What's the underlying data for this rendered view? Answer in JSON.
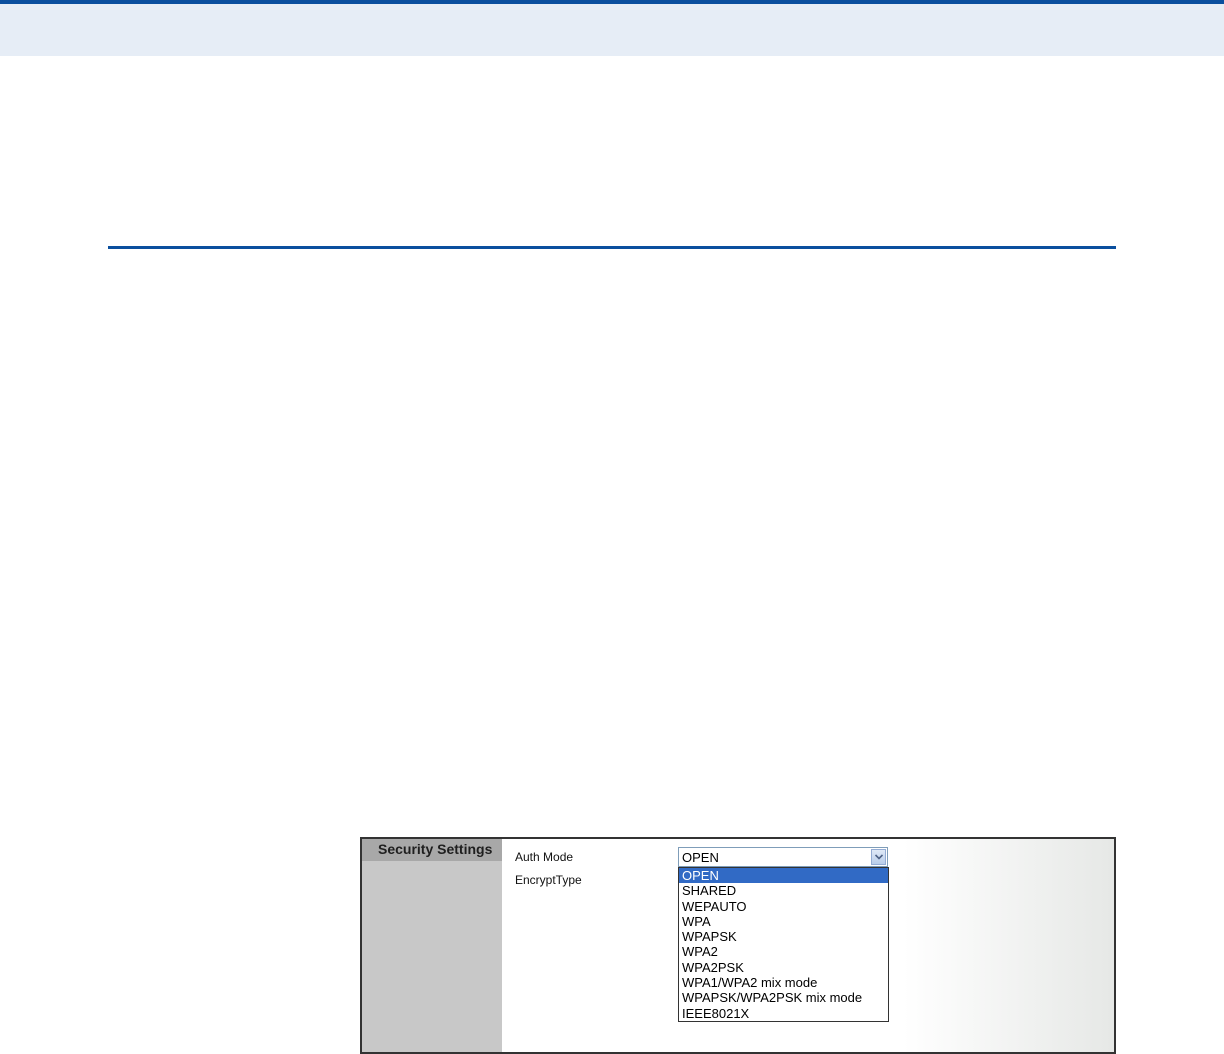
{
  "panel": {
    "title": "Security Settings",
    "fields": {
      "auth_mode_label": "Auth Mode",
      "encrypt_type_label": "EncryptType"
    },
    "auth_mode_select": {
      "value": "OPEN",
      "options": [
        "OPEN",
        "SHARED",
        "WEPAUTO",
        "WPA",
        "WPAPSK",
        "WPA2",
        "WPA2PSK",
        "WPA1/WPA2 mix mode",
        "WPAPSK/WPA2PSK mix mode",
        "IEEE8021X"
      ],
      "highlighted_index": 0
    }
  },
  "colors": {
    "accent": "#0a4f9e",
    "band": "#e6edf6",
    "selection": "#316ac5",
    "sidebar": "#c8c8c8"
  },
  "icons": {
    "dropdown_arrow": "chevron-down-icon"
  }
}
